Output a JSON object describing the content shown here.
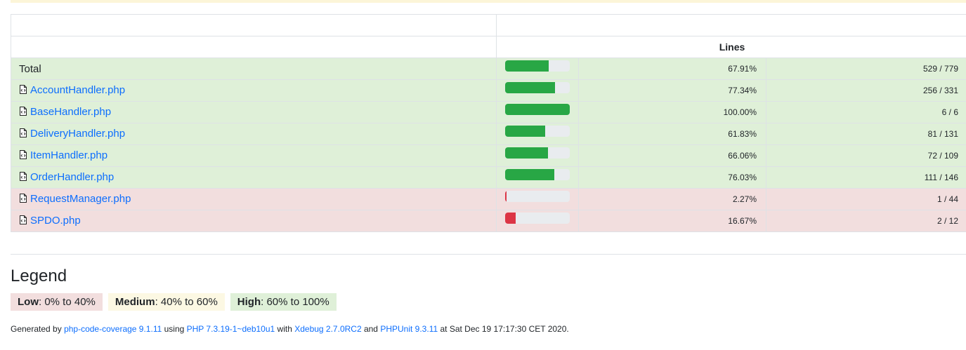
{
  "header": {
    "lines_label": "Lines"
  },
  "rows": [
    {
      "name": "Total",
      "link": false,
      "level": "high",
      "percent": 67.91,
      "percent_text": "67.91%",
      "lines": "529 / 779"
    },
    {
      "name": "AccountHandler.php",
      "link": true,
      "level": "high",
      "percent": 77.34,
      "percent_text": "77.34%",
      "lines": "256 / 331"
    },
    {
      "name": "BaseHandler.php",
      "link": true,
      "level": "high",
      "percent": 100.0,
      "percent_text": "100.00%",
      "lines": "6 / 6"
    },
    {
      "name": "DeliveryHandler.php",
      "link": true,
      "level": "high",
      "percent": 61.83,
      "percent_text": "61.83%",
      "lines": "81 / 131"
    },
    {
      "name": "ItemHandler.php",
      "link": true,
      "level": "high",
      "percent": 66.06,
      "percent_text": "66.06%",
      "lines": "72 / 109"
    },
    {
      "name": "OrderHandler.php",
      "link": true,
      "level": "high",
      "percent": 76.03,
      "percent_text": "76.03%",
      "lines": "111 / 146"
    },
    {
      "name": "RequestManager.php",
      "link": true,
      "level": "low",
      "percent": 2.27,
      "percent_text": "2.27%",
      "lines": "1 / 44"
    },
    {
      "name": "SPDO.php",
      "link": true,
      "level": "low",
      "percent": 16.67,
      "percent_text": "16.67%",
      "lines": "2 / 12"
    }
  ],
  "legend": {
    "title": "Legend",
    "low": {
      "label": "Low",
      "range": ": 0% to 40%"
    },
    "medium": {
      "label": "Medium",
      "range": ": 40% to 60%"
    },
    "high": {
      "label": "High",
      "range": ": 60% to 100%"
    }
  },
  "footer": {
    "t1": "Generated by ",
    "link1": "php-code-coverage 9.1.11",
    "t2": " using ",
    "link2": "PHP 7.3.19-1~deb10u1",
    "t3": " with ",
    "link3": "Xdebug 2.7.0RC2",
    "t4": " and ",
    "link4": "PHPUnit 9.3.11",
    "t5": " at Sat Dec 19 17:17:30 CET 2020."
  },
  "colors": {
    "success": "#28a745",
    "danger": "#dc3545",
    "high_bg": "#dff0d8",
    "low_bg": "#f2dede",
    "medium_bg": "#fcf8e3",
    "link": "#0d6efd"
  }
}
